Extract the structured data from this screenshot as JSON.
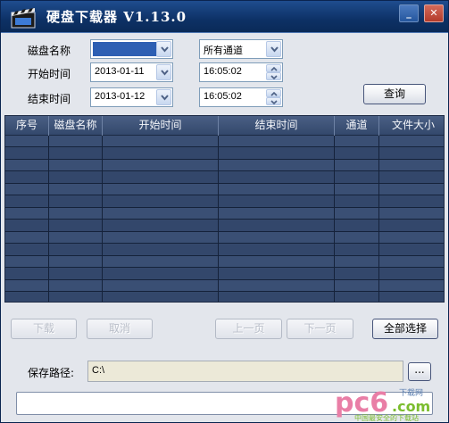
{
  "window": {
    "title": "硬盘下载器 V1.13.0",
    "minimize_glyph": "_",
    "close_glyph": "✕"
  },
  "filters": {
    "disk_name_label": "磁盘名称",
    "disk_name_value": "",
    "channel_value": "所有通道",
    "start_label": "开始时间",
    "start_date": "2013-01-11",
    "start_time": "16:05:02",
    "end_label": "结束时间",
    "end_date": "2013-01-12",
    "end_time": "16:05:02",
    "query_button": "查询"
  },
  "table": {
    "columns": [
      "序号",
      "磁盘名称",
      "开始时间",
      "结束时间",
      "通道",
      "文件大小"
    ],
    "rows": []
  },
  "actions": {
    "download": "下载",
    "cancel": "取消",
    "prev_page": "上一页",
    "next_page": "下一页",
    "select_all": "全部选择"
  },
  "save": {
    "label": "保存路径:",
    "path": "C:\\",
    "browse": "..."
  },
  "status_text": "",
  "watermark": {
    "brand": "pc6",
    "domain": ".com",
    "tag": "下载网",
    "slogan": "中国最安全的下载站"
  },
  "icons": {
    "app": "clapperboard-icon",
    "dropdown": "chevron-down-icon",
    "spin_up": "triangle-up-icon",
    "spin_down": "triangle-down-icon"
  },
  "colors": {
    "titlebar": "#0d3166",
    "table_bg": "#34486b",
    "window_bg": "#e3e6ec"
  }
}
